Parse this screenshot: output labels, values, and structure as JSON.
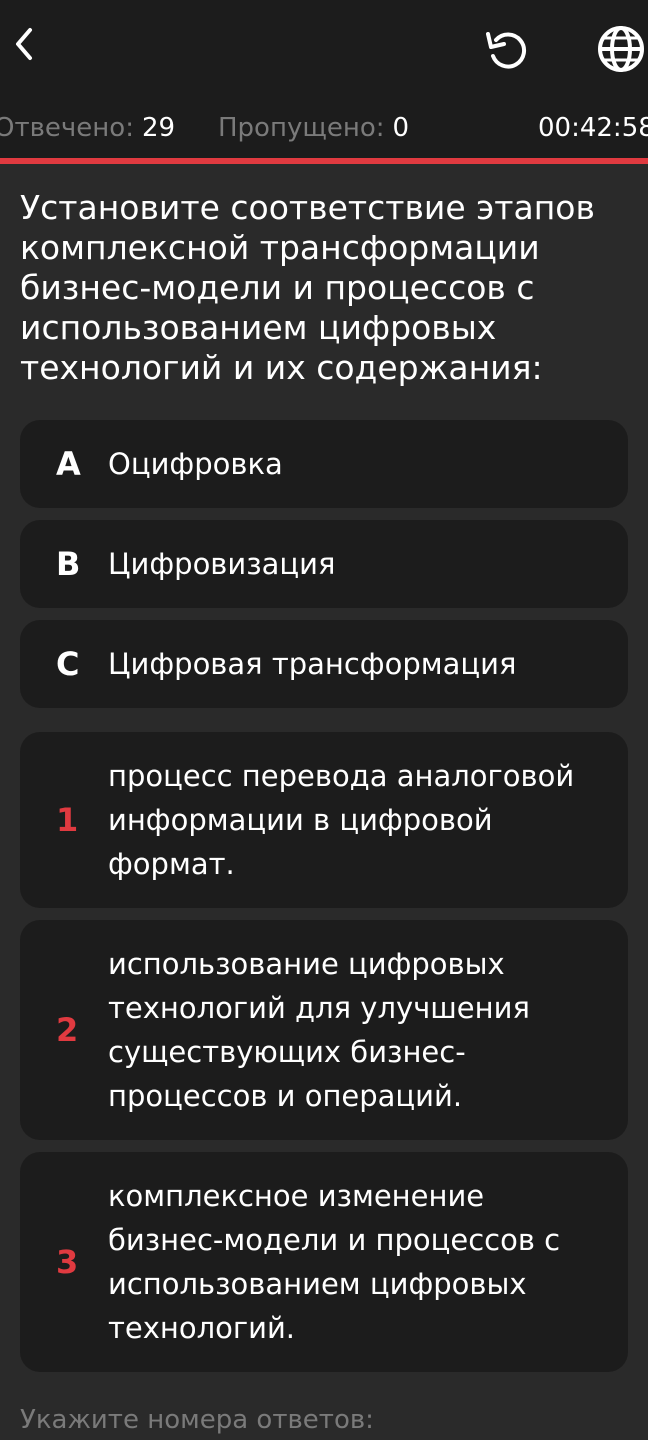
{
  "header": {
    "back_icon": "chevron-left-icon",
    "reload_icon": "reload-icon",
    "language_icon": "globe-icon"
  },
  "status": {
    "answered_label": "Отвечено:",
    "answered_value": "29",
    "skipped_label": "Пропущено:",
    "skipped_value": "0",
    "timer": "00:42:58",
    "accent_color": "#e03a40"
  },
  "question": {
    "text": "Установите соответствие этапов комплексной трансформации бизнес-модели и процессов с использованием цифровых технологий и их содержания:"
  },
  "options": [
    {
      "letter": "A",
      "label": "Оцифровка"
    },
    {
      "letter": "B",
      "label": "Цифровизация"
    },
    {
      "letter": "C",
      "label": "Цифровая трансформация"
    }
  ],
  "definitions": [
    {
      "number": "1",
      "text": "процесс перевода аналоговой информации в цифровой формат."
    },
    {
      "number": "2",
      "text": "использование цифровых технологий для улучшения существующих бизнес-процессов и операций."
    },
    {
      "number": "3",
      "text": "комплексное изменение бизнес-модели и процессов с использованием цифровых технологий."
    }
  ],
  "answer_hint": "Укажите номера ответов:"
}
